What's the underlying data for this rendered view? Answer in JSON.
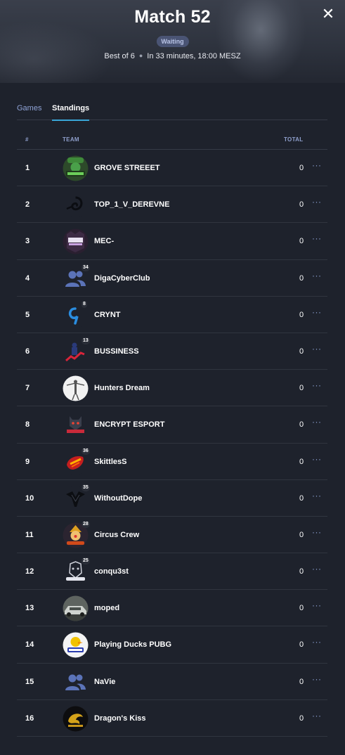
{
  "header": {
    "title": "Match 52",
    "status": "Waiting",
    "format": "Best of 6",
    "schedule": "In 33 minutes, 18:00 MESZ",
    "close_icon": "close-icon"
  },
  "tabs": [
    {
      "label": "Games",
      "active": false
    },
    {
      "label": "Standings",
      "active": true
    }
  ],
  "table": {
    "columns": {
      "rank": "#",
      "team": "TEAM",
      "total": "TOTAL"
    },
    "rows": [
      {
        "rank": "1",
        "name": "GROVE STREEET",
        "total": "0",
        "members": "",
        "logo": "grove-street-logo"
      },
      {
        "rank": "2",
        "name": "TOP_1_V_DEREVNE",
        "total": "0",
        "members": "",
        "logo": "spiral-logo"
      },
      {
        "rank": "3",
        "name": "MEC-",
        "total": "0",
        "members": "",
        "logo": "mec-esports-logo"
      },
      {
        "rank": "4",
        "name": "DigaCyberClub",
        "total": "0",
        "members": "34",
        "logo": "default-team-icon"
      },
      {
        "rank": "5",
        "name": "CRYNT",
        "total": "0",
        "members": "8",
        "logo": "crynt-logo"
      },
      {
        "rank": "6",
        "name": "BUSSINESS",
        "total": "0",
        "members": "13",
        "logo": "bussiness-logo"
      },
      {
        "rank": "7",
        "name": "Hunters Dream",
        "total": "0",
        "members": "",
        "logo": "hunters-dream-logo"
      },
      {
        "rank": "8",
        "name": "ENCRYPT ESPORT",
        "total": "0",
        "members": "",
        "logo": "encrypt-logo"
      },
      {
        "rank": "9",
        "name": "SkittlesS",
        "total": "0",
        "members": "36",
        "logo": "skittles-logo"
      },
      {
        "rank": "10",
        "name": "WithoutDope",
        "total": "0",
        "members": "35",
        "logo": "withoutdope-logo"
      },
      {
        "rank": "11",
        "name": "Circus Crew",
        "total": "0",
        "members": "28",
        "logo": "circus-crew-logo"
      },
      {
        "rank": "12",
        "name": "conqu3st",
        "total": "0",
        "members": "25",
        "logo": "conquest-logo"
      },
      {
        "rank": "13",
        "name": "moped",
        "total": "0",
        "members": "",
        "logo": "moped-car-logo"
      },
      {
        "rank": "14",
        "name": "Playing Ducks PUBG",
        "total": "0",
        "members": "",
        "logo": "playing-ducks-logo"
      },
      {
        "rank": "15",
        "name": "NaVie",
        "total": "0",
        "members": "",
        "logo": "default-team-icon"
      },
      {
        "rank": "16",
        "name": "Dragon's Kiss",
        "total": "0",
        "members": "",
        "logo": "dragons-kiss-logo"
      }
    ],
    "row_menu_icon": "more-horizontal-icon"
  },
  "colors": {
    "background": "#1e222c",
    "accent": "#39a6d8",
    "link": "#8fa3d6",
    "badge": "#4a5474"
  }
}
